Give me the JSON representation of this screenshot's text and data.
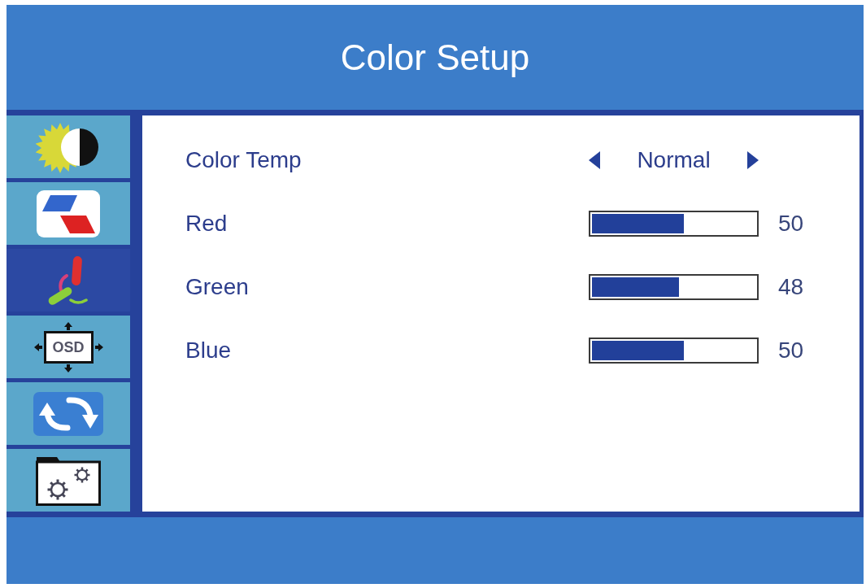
{
  "header": {
    "title": "Color Setup"
  },
  "sidebar": {
    "items": [
      {
        "kind": "brightness",
        "selected": false
      },
      {
        "kind": "picture",
        "selected": false
      },
      {
        "kind": "color",
        "selected": true
      },
      {
        "kind": "osd",
        "label": "OSD",
        "selected": false
      },
      {
        "kind": "reset",
        "selected": false
      },
      {
        "kind": "settings",
        "selected": false
      }
    ]
  },
  "settings": [
    {
      "kind": "selector",
      "label": "Color Temp",
      "value": "Normal"
    },
    {
      "kind": "slider",
      "label": "Red",
      "level": 0.56,
      "reading": "50"
    },
    {
      "kind": "slider",
      "label": "Green",
      "level": 0.53,
      "reading": "48"
    },
    {
      "kind": "slider",
      "label": "Blue",
      "level": 0.56,
      "reading": "50"
    }
  ]
}
